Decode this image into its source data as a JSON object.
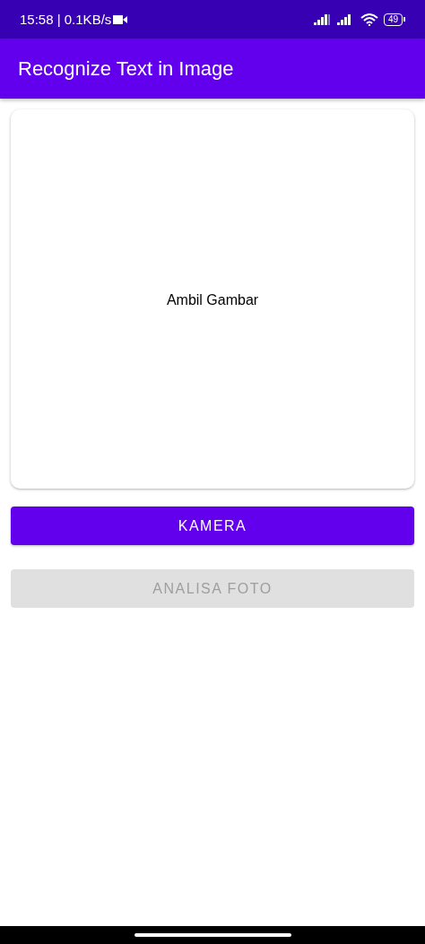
{
  "status_bar": {
    "time_and_speed": "15:58 | 0.1KB/s",
    "battery": "49"
  },
  "app_bar": {
    "title": "Recognize Text in Image"
  },
  "image_card": {
    "label": "Ambil Gambar"
  },
  "buttons": [
    {
      "label": "KAMERA",
      "disabled": false
    },
    {
      "label": "ANALISA FOTO",
      "disabled": true
    }
  ]
}
